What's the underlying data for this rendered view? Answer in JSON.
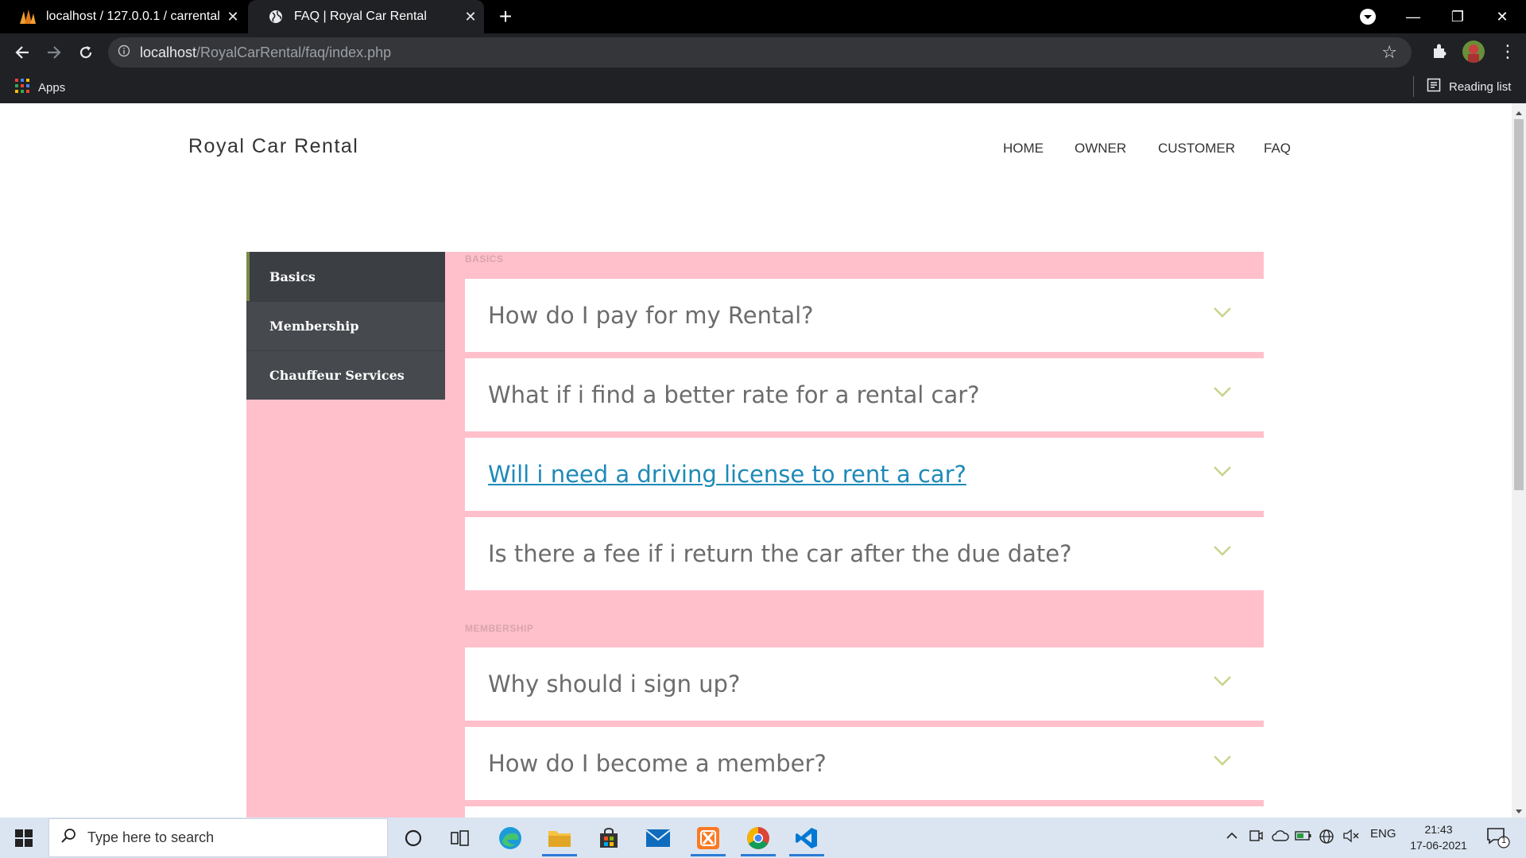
{
  "browser": {
    "tabs": [
      {
        "title": "localhost / 127.0.0.1 / carrental |",
        "active": false,
        "close": "✕"
      },
      {
        "title": "FAQ | Royal Car Rental",
        "active": true,
        "close": "✕"
      }
    ],
    "new_tab": "+",
    "window_controls": {
      "minimize": "—",
      "restore": "❐",
      "close": "✕"
    },
    "url_host": "localhost",
    "url_path": "/RoyalCarRental/faq/index.php",
    "bookmarks": {
      "apps": "Apps",
      "reading_list": "Reading list"
    }
  },
  "site": {
    "brand": "Royal Car Rental",
    "nav": [
      "HOME",
      "OWNER",
      "CUSTOMER",
      "FAQ"
    ]
  },
  "faq": {
    "categories": [
      {
        "label": "Basics",
        "selected": true
      },
      {
        "label": "Membership",
        "selected": false
      },
      {
        "label": "Chauffeur Services",
        "selected": false
      }
    ],
    "groups": [
      {
        "title": "BASICS",
        "questions": [
          {
            "q": "How do I pay for my Rental?",
            "hover": false
          },
          {
            "q": "What if i find a better rate for a rental car?",
            "hover": false
          },
          {
            "q": "Will i need a driving license to rent a car?",
            "hover": true
          },
          {
            "q": "Is there a fee if i return the car after the due date?",
            "hover": false
          }
        ]
      },
      {
        "title": "MEMBERSHIP",
        "questions": [
          {
            "q": "Why should i sign up?",
            "hover": false
          },
          {
            "q": "How do I become a member?",
            "hover": false
          }
        ]
      }
    ],
    "accent_colors": {
      "panel_bg": "#ffc0cb",
      "sidebar_item_bg": "#464a4f",
      "chevron": "#c8d48a",
      "link_hover": "#1e8ab8"
    }
  },
  "taskbar": {
    "search_placeholder": "Type here to search",
    "language": "ENG",
    "time": "21:43",
    "date": "17-06-2021",
    "notifications_count": "1"
  }
}
